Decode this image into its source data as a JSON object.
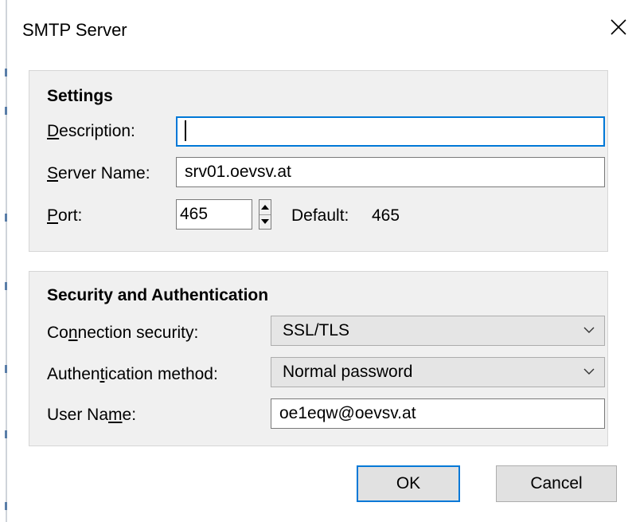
{
  "window": {
    "title": "SMTP Server"
  },
  "settings": {
    "heading": "Settings",
    "description": {
      "label_key": "D",
      "label_rest": "escription:",
      "value": ""
    },
    "server_name": {
      "label_key": "S",
      "label_rest": "erver Name:",
      "value": "srv01.oevsv.at"
    },
    "port": {
      "label_key": "P",
      "label_rest": "ort:",
      "value": "465",
      "default_label": "Default:",
      "default_value": "465"
    }
  },
  "security": {
    "heading": "Security and Authentication",
    "connection_security": {
      "label_pre": "Co",
      "label_key": "n",
      "label_post": "nection security:",
      "selected": "SSL/TLS"
    },
    "auth_method": {
      "label_pre": "Authen",
      "label_key": "t",
      "label_post": "ication method:",
      "selected": "Normal password"
    },
    "user_name": {
      "label_pre": "User Na",
      "label_key": "m",
      "label_post": "e:",
      "value": "oe1eqw@oevsv.at"
    }
  },
  "buttons": {
    "ok": "OK",
    "cancel": "Cancel"
  },
  "colors": {
    "focus": "#0078d7",
    "group_bg": "#f0f0f0",
    "button_bg": "#e1e1e1"
  },
  "icons": {
    "close": "close-icon",
    "spin_up": "arrow-up-icon",
    "spin_down": "arrow-down-icon",
    "dropdown": "chevron-down-icon"
  }
}
